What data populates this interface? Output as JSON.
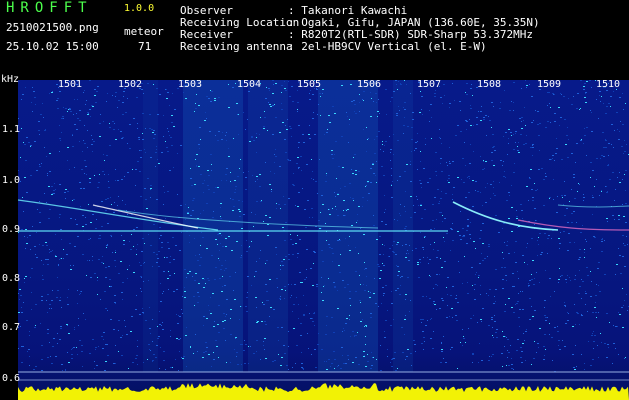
{
  "app": {
    "title": "HROFFT",
    "version": "1.0.0"
  },
  "file": "2510021500.png",
  "datetime": "25.10.02 15:00",
  "meteor": {
    "label": "meteor",
    "count": "71"
  },
  "info": [
    {
      "label": "Observer",
      "value": ": Takanori Kawachi"
    },
    {
      "label": "Receiving Location",
      "value": ": Ogaki, Gifu, JAPAN (136.60E, 35.35N)"
    },
    {
      "label": "Receiver",
      "value": ": R820T2(RTL-SDR) SDR-Sharp 53.372MHz"
    },
    {
      "label": "Receiving antenna",
      "value": ": 2el-HB9CV Vertical (el. E-W)"
    }
  ],
  "axis": {
    "y_unit": "kHz",
    "x_ticks": [
      "1501",
      "1502",
      "1503",
      "1504",
      "1505",
      "1506",
      "1507",
      "1508",
      "1509",
      "1510"
    ],
    "y_ticks": [
      "1.1",
      "1.0",
      "0.9",
      "0.8",
      "0.7",
      "0.6"
    ]
  },
  "colors": {
    "header_green": "#4cff4c",
    "header_yellow": "#ffff33",
    "background_blue": "#0a1a8c",
    "signal_cyan": "#33e6ff",
    "bottom_trace_yellow": "#ffff00"
  }
}
